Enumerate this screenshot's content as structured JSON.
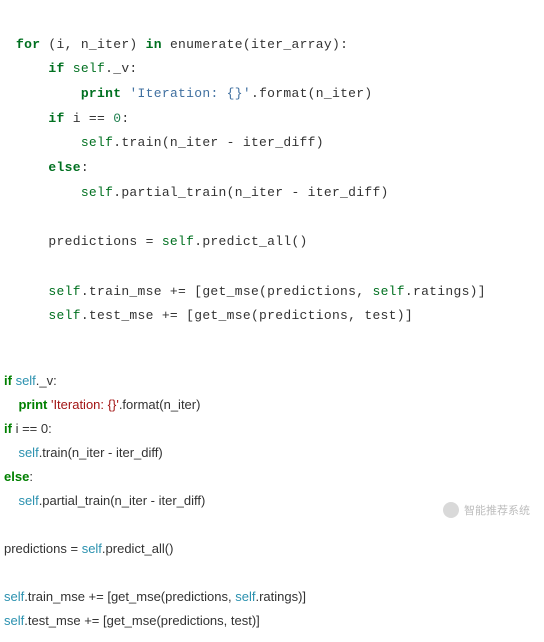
{
  "block1": {
    "l1": {
      "kw1": "for",
      "p1": " (i, n_iter) ",
      "kw2": "in",
      "p2": " enumerate(iter_array):"
    },
    "l2": {
      "kw": "if",
      "s": "self",
      "rest": "._v:"
    },
    "l3": {
      "kw": "print",
      "str": "'Iteration: {}'",
      "rest": ".format(n_iter)"
    },
    "l4": {
      "kw": "if",
      "rest": " i == ",
      "num": "0",
      "colon": ":"
    },
    "l5": {
      "s": "self",
      "rest": ".train(n_iter - iter_diff)"
    },
    "l6": {
      "kw": "else",
      "colon": ":"
    },
    "l7": {
      "s": "self",
      "rest": ".partial_train(n_iter - iter_diff)"
    },
    "l8": {
      "pre": "predictions = ",
      "s": "self",
      "rest": ".predict_all()"
    },
    "l9": {
      "s1": "self",
      "p1": ".train_mse += [get_mse(predictions, ",
      "s2": "self",
      "p2": ".ratings)]"
    },
    "l10": {
      "s": "self",
      "rest": ".test_mse += [get_mse(predictions, test)]"
    }
  },
  "block2": {
    "l1": {
      "kw": "if",
      "s": " self",
      "rest": "._v:"
    },
    "l2": {
      "kw": "print",
      "str": " 'Iteration: {}'",
      "rest": ".format(n_iter)"
    },
    "l3": {
      "kw": "if",
      "rest": " i == 0:"
    },
    "l4": {
      "s": "self",
      "rest": ".train(n_iter - iter_diff)"
    },
    "l5": {
      "kw": "else",
      "colon": ":"
    },
    "l6": {
      "s": "self",
      "rest": ".partial_train(n_iter - iter_diff)"
    },
    "l7": {
      "pre": "predictions = ",
      "s": "self",
      "rest": ".predict_all()"
    },
    "l8": {
      "s1": "self",
      "p1": ".train_mse += [get_mse(predictions, ",
      "s2": "self",
      "p2": ".ratings)]"
    },
    "l9": {
      "s": "self",
      "rest": ".test_mse += [get_mse(predictions, test)]"
    }
  },
  "watermark": "智能推荐系统"
}
